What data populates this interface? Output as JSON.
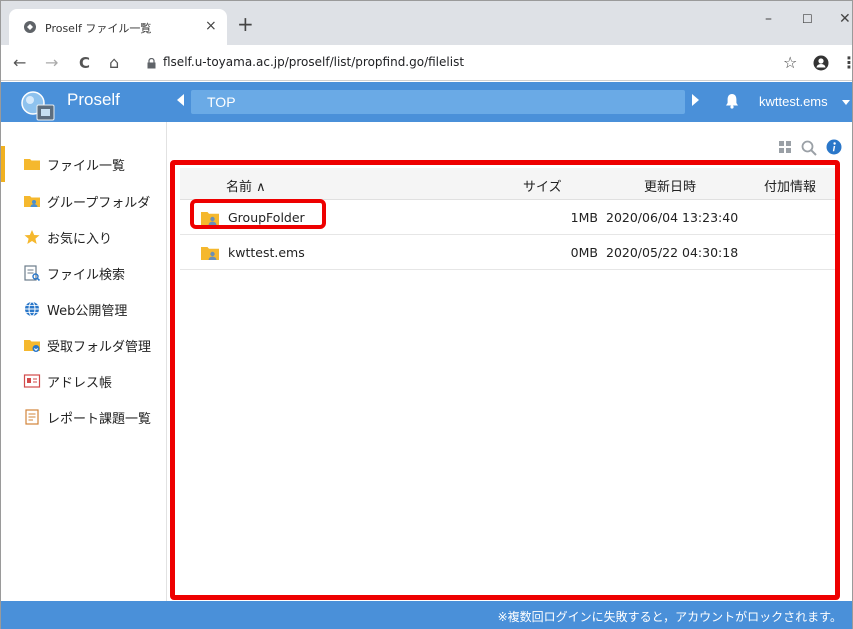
{
  "browser": {
    "tab_title": "Proself ファイル一覧",
    "tab_close": "×",
    "new_tab": "+",
    "url": "flself.u-toyama.ac.jp/proself/list/propfind.go/filelist",
    "window_controls": {
      "minimize": "–",
      "maximize": "☐",
      "close": "✕"
    },
    "nav": {
      "back": "←",
      "forward": "→",
      "reload": "C",
      "home": "⌂"
    },
    "star": "☆",
    "menu": "⋮"
  },
  "app": {
    "brand": "Proself",
    "breadcrumb": "TOP",
    "user": "kwttest.ems",
    "accent_color": "#4a90d9"
  },
  "sidebar": {
    "items": [
      {
        "label": "ファイル一覧",
        "icon": "folder-icon",
        "active": true
      },
      {
        "label": "グループフォルダ",
        "icon": "group-folder-icon"
      },
      {
        "label": "お気に入り",
        "icon": "star-icon"
      },
      {
        "label": "ファイル検索",
        "icon": "file-search-icon"
      },
      {
        "label": "Web公開管理",
        "icon": "globe-icon"
      },
      {
        "label": "受取フォルダ管理",
        "icon": "receive-folder-icon"
      },
      {
        "label": "アドレス帳",
        "icon": "address-book-icon"
      },
      {
        "label": "レポート課題一覧",
        "icon": "report-icon"
      }
    ]
  },
  "table": {
    "columns": {
      "name": "名前 ∧",
      "size": "サイズ",
      "modified": "更新日時",
      "extra": "付加情報"
    },
    "rows": [
      {
        "name": "GroupFolder",
        "size": "1MB",
        "modified": "2020/06/04 13:23:40"
      },
      {
        "name": "kwttest.ems",
        "size": "0MB",
        "modified": "2020/05/22 04:30:18"
      }
    ]
  },
  "footer": {
    "notice": "※複数回ログインに失敗すると，アカウントがロックされます。"
  }
}
